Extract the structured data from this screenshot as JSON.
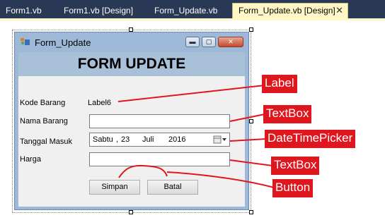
{
  "tabs": [
    {
      "label": "Form1.vb"
    },
    {
      "label": "Form1.vb [Design]"
    },
    {
      "label": "Form_Update.vb"
    },
    {
      "label": "Form_Update.vb [Design]",
      "close": "✕"
    }
  ],
  "form": {
    "title": "Form_Update",
    "caption_buttons": {
      "minimize": "▬",
      "maximize": "▢",
      "close": "✕"
    },
    "header": "FORM UPDATE",
    "fields": {
      "kode_barang_label": "Kode Barang",
      "kode_barang_value": "Label6",
      "nama_barang_label": "Nama Barang",
      "tanggal_masuk_label": "Tanggal Masuk",
      "harga_label": "Harga"
    },
    "date_picker": {
      "day_name": "Sabtu",
      "separator": ",",
      "day": "23",
      "month": "Juli",
      "year": "2016"
    },
    "buttons": {
      "simpan": "Simpan",
      "batal": "Batal"
    }
  },
  "annotations": {
    "label": "Label",
    "textbox1": "TextBox",
    "datetimepicker": "DateTimePicker",
    "textbox2": "TextBox",
    "button": "Button"
  },
  "colors": {
    "annotation": "#e0161e",
    "tab_active": "#fff7c6",
    "ide_bg": "#293955"
  }
}
